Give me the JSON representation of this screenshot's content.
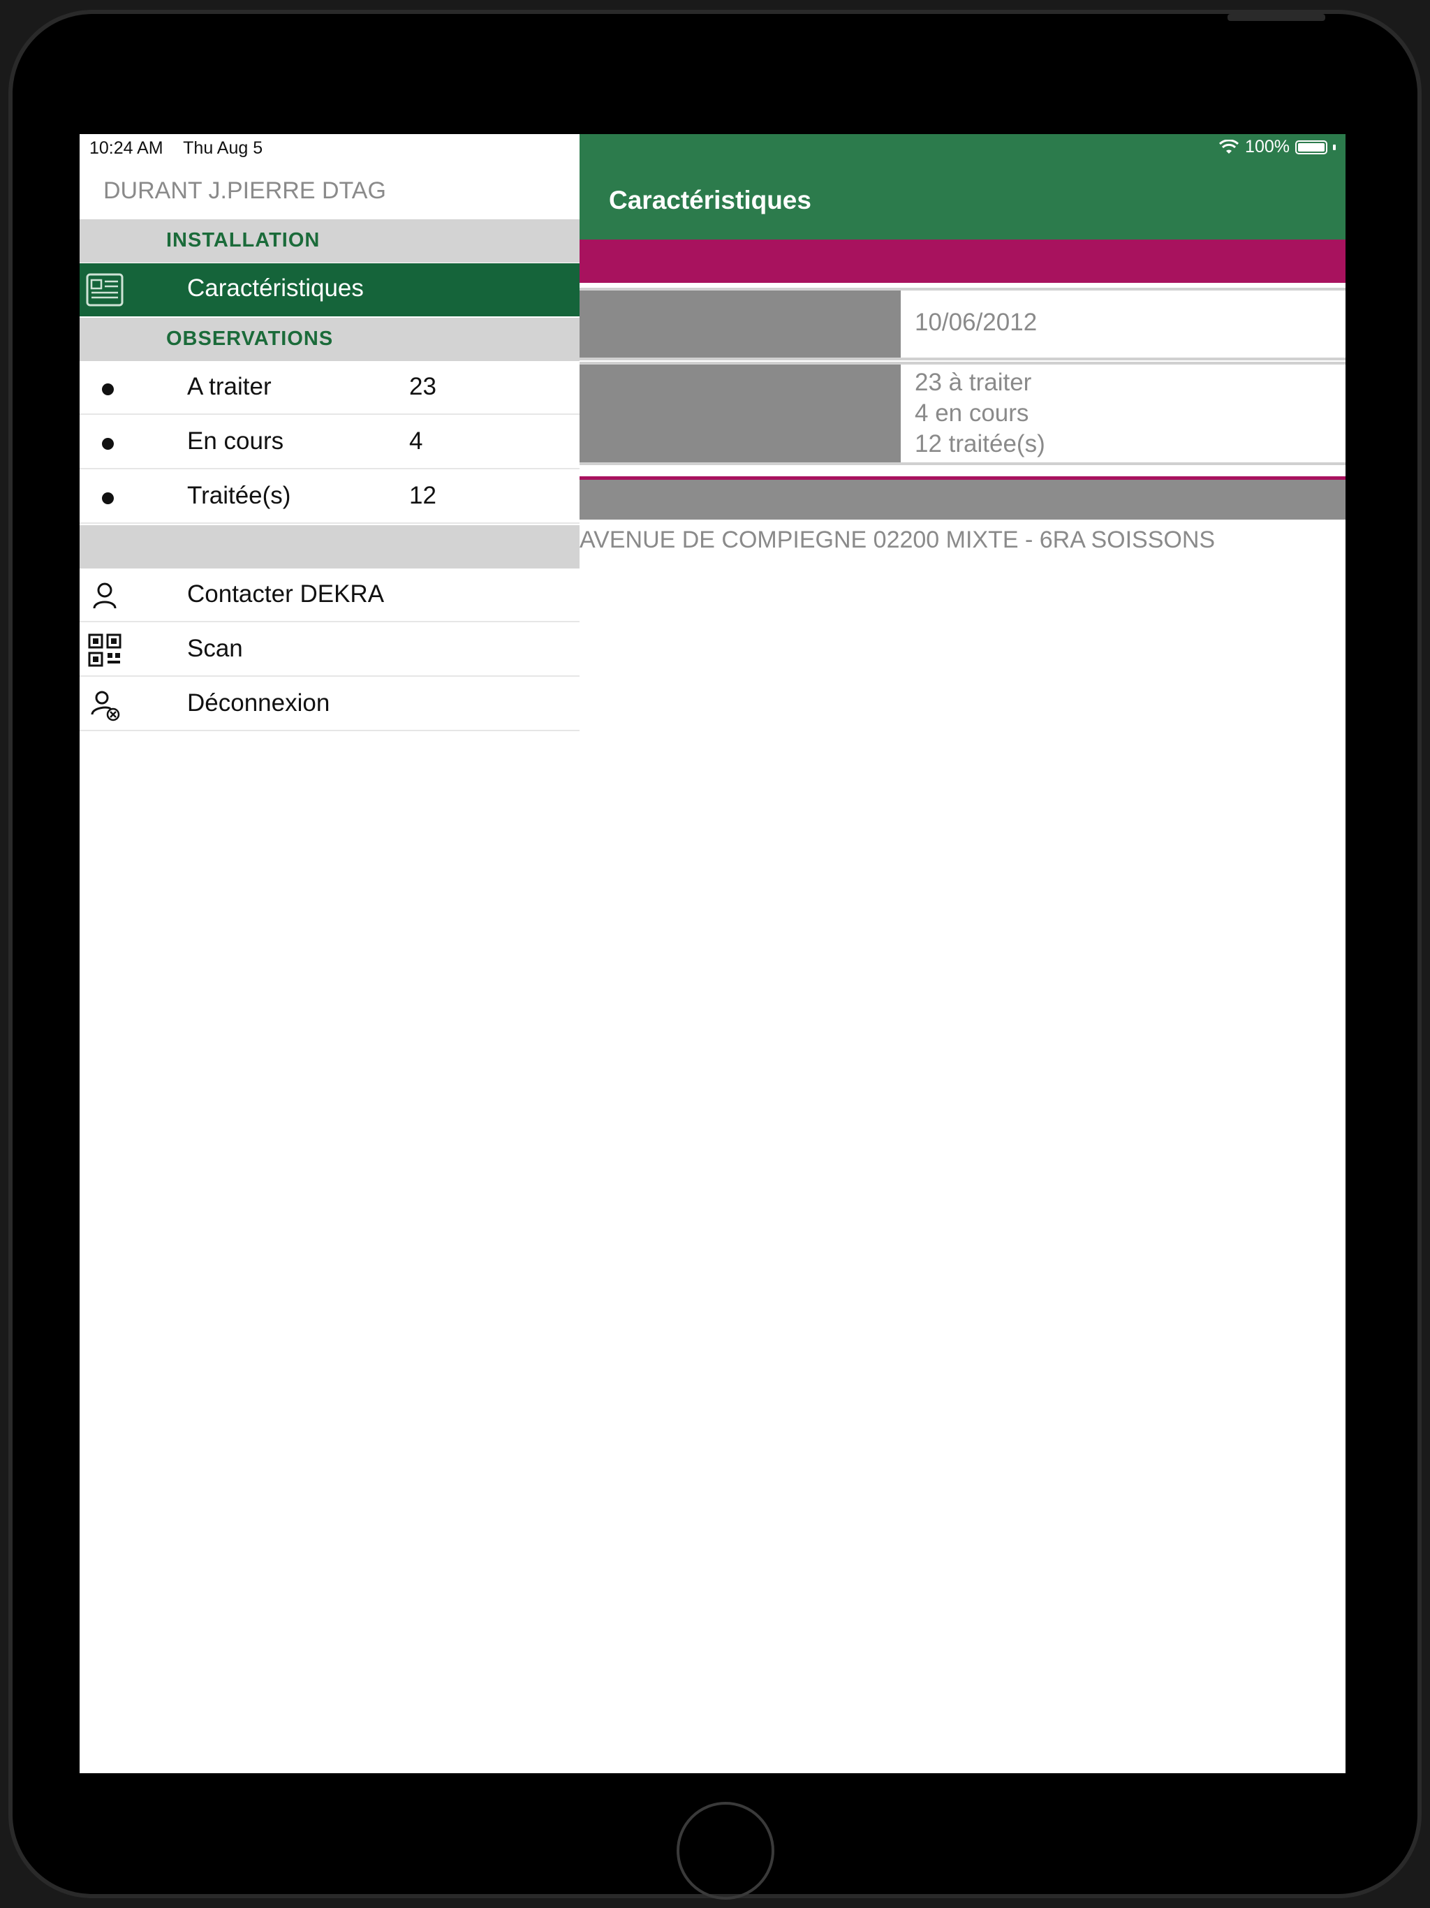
{
  "status": {
    "time": "10:24 AM",
    "date": "Thu Aug 5",
    "battery": "100%"
  },
  "sidebar": {
    "user": "DURANT J.PIERRE DTAG",
    "sections": {
      "installation": "INSTALLATION",
      "observations": "OBSERVATIONS"
    },
    "installation_items": [
      {
        "label": "Caractéristiques",
        "icon": "id-card-icon",
        "active": true
      }
    ],
    "observation_items": [
      {
        "label": "A traiter",
        "count": "23"
      },
      {
        "label": "En cours",
        "count": "4"
      },
      {
        "label": "Traitée(s)",
        "count": "12"
      }
    ],
    "actions": [
      {
        "label": "Contacter DEKRA",
        "icon": "person-icon"
      },
      {
        "label": "Scan",
        "icon": "qr-code-icon"
      },
      {
        "label": "Déconnexion",
        "icon": "logout-person-icon"
      }
    ]
  },
  "main": {
    "title": "Caractéristiques",
    "date_value": "10/06/2012",
    "observations_summary": [
      "23 à traiter",
      "4 en cours",
      "12 traitée(s)"
    ],
    "address": "AVENUE DE COMPIEGNE 02200 MIXTE - 6RA SOISSONS"
  },
  "colors": {
    "primary_green": "#2c7b4c",
    "active_green": "#15643a",
    "accent_magenta": "#a8125e",
    "section_gray": "#d3d3d3"
  }
}
